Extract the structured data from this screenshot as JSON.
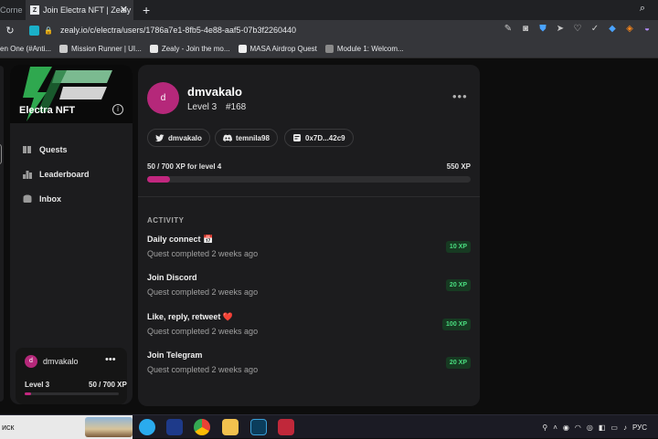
{
  "browser": {
    "prev_tab_label": "Corne",
    "active_tab_title": "Join Electra NFT | Zealy",
    "url": "zealy.io/c/electra/users/1786a7e1-8fb5-4e88-aaf5-07b3f2260440",
    "bookmarks": [
      {
        "label": "en One (#Anti...",
        "color": "#ff7a00"
      },
      {
        "label": "Mission Runner | UI...",
        "color": "#cccccc"
      },
      {
        "label": "Zealy - Join the mo...",
        "color": "#e8e8e8"
      },
      {
        "label": "MASA Airdrop Quest",
        "color": "#f0f0f0"
      },
      {
        "label": "Module 1: Welcom...",
        "color": "#e8e8e8"
      }
    ]
  },
  "sidebar": {
    "community_name": "Electra NFT",
    "nav": [
      {
        "label": "Quests",
        "icon": "quests-icon"
      },
      {
        "label": "Leaderboard",
        "icon": "leaderboard-icon"
      },
      {
        "label": "Inbox",
        "icon": "inbox-icon"
      }
    ],
    "user_card": {
      "avatar_letter": "d",
      "name": "dmvakalo",
      "level": "Level 3",
      "xp": "50 / 700 XP",
      "progress": 0.0714
    }
  },
  "profile": {
    "avatar_letter": "d",
    "username": "dmvakalo",
    "level": "Level 3",
    "rank": "#168",
    "links": [
      {
        "label": "dmvakalo",
        "icon": "twitter-icon"
      },
      {
        "label": "temnila98",
        "icon": "discord-icon"
      },
      {
        "label": "0x7D...42c9",
        "icon": "wallet-icon"
      }
    ],
    "xp_label": "50 / 700 XP for level 4",
    "xp_next": "550 XP",
    "xp_progress": 0.0714,
    "activity_heading": "ACTIVITY",
    "activity": [
      {
        "title": "Daily connect 📅",
        "subtitle": "Quest completed 2 weeks ago",
        "xp": "10 XP"
      },
      {
        "title": "Join Discord",
        "subtitle": "Quest completed 2 weeks ago",
        "xp": "20 XP"
      },
      {
        "title": "Like, reply, retweet ❤️",
        "subtitle": "Quest completed 2 weeks ago",
        "xp": "100 XP"
      },
      {
        "title": "Join Telegram",
        "subtitle": "Quest completed 2 weeks ago",
        "xp": "20 XP"
      }
    ]
  },
  "taskbar": {
    "search_text": "иск",
    "language": "РУС"
  },
  "colors": {
    "accent": "#c2277f",
    "avatar": "#b5287a",
    "xp_badge_text": "#4ade80",
    "panel": "#1c1c1e"
  }
}
